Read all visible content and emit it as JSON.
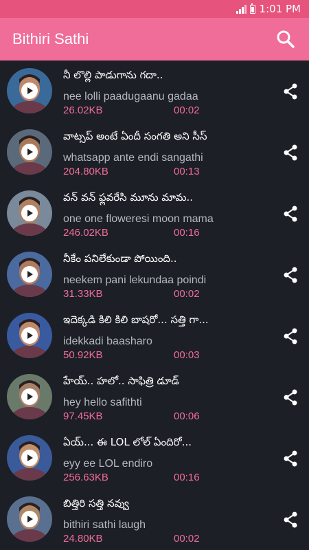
{
  "status_bar": {
    "time": "1:01 PM"
  },
  "app_bar": {
    "title": "Bithiri Sathi"
  },
  "colors": {
    "accent": "#f06d99",
    "status": "#e6547e",
    "background": "#1c1f26"
  },
  "items": [
    {
      "title": "నీ లొల్లి పాడుగాను గదా..",
      "subtitle": "nee lolli paadugaanu gadaa",
      "size": "26.02KB",
      "duration": "00:02"
    },
    {
      "title": "వాట్సప్ అంటే ఏందీ సంగతి అని సీస్",
      "subtitle": "whatsapp ante endi sangathi",
      "size": "204.80KB",
      "duration": "00:13"
    },
    {
      "title": "వన్ వన్ ఫ్లవరేసి మూను మామ..",
      "subtitle": "one one floweresi moon mama",
      "size": "246.02KB",
      "duration": "00:16"
    },
    {
      "title": "నీకేం పనిలేకుండా పోయింది..",
      "subtitle": "neekem pani lekundaa poindi",
      "size": "31.33KB",
      "duration": "00:02"
    },
    {
      "title": "ఇదెక్కడి కిలి కిలి బాషరో... సత్తి గా...",
      "subtitle": "idekkadi baasharo",
      "size": "50.92KB",
      "duration": "00:03"
    },
    {
      "title": "హేయ్.. హలో.. సాఫిత్రి డూడ్",
      "subtitle": "hey hello safithti",
      "size": "97.45KB",
      "duration": "00:06"
    },
    {
      "title": "ఏయ్... ఈ LOL లోల్ ఏందిరో...",
      "subtitle": "eyy ee LOL endiro",
      "size": "256.63KB",
      "duration": "00:16"
    },
    {
      "title": "బిత్తిరి సత్తి నవ్వు",
      "subtitle": "bithiri sathi laugh",
      "size": "24.80KB",
      "duration": "00:02"
    }
  ]
}
